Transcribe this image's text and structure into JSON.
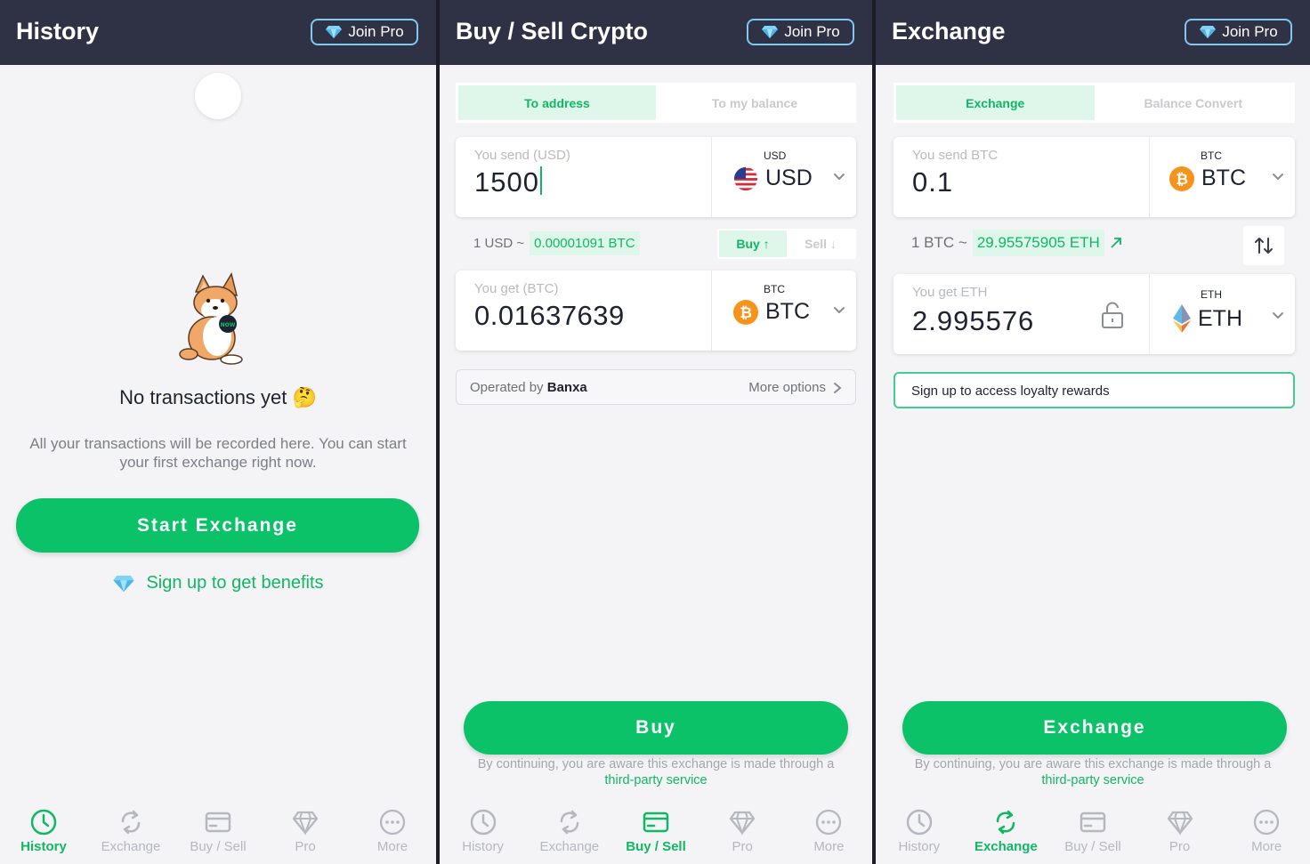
{
  "pro_label": "Join Pro",
  "nav": [
    "History",
    "Exchange",
    "Buy / Sell",
    "Pro",
    "More"
  ],
  "history": {
    "title": "History",
    "empty_title": "No transactions yet",
    "empty_emoji": "🤔",
    "empty_text": "All your transactions will be recorded here. You can start your first exchange right now.",
    "start_button": "Start Exchange",
    "signup_link": "Sign up to get benefits"
  },
  "buysell": {
    "title": "Buy / Sell Crypto",
    "tabs": [
      "To address",
      "To my balance"
    ],
    "send_label": "You send (USD)",
    "send_value": "1500",
    "send_currency_small": "USD",
    "send_currency": "USD",
    "rate_prefix": "1 USD ~",
    "rate_value": "0.00001091 BTC",
    "buy_toggle": "Buy ↑",
    "sell_toggle": "Sell ↓",
    "get_label": "You get (BTC)",
    "get_value": "0.01637639",
    "get_currency_small": "BTC",
    "get_currency": "BTC",
    "operated_prefix": "Operated by",
    "operated_by": "Banxa",
    "more_options": "More options",
    "buy_button": "Buy",
    "disclaimer": "By continuing, you are aware this exchange is made through a",
    "disclaimer_link": "third-party service"
  },
  "exchange": {
    "title": "Exchange",
    "tabs": [
      "Exchange",
      "Balance Convert"
    ],
    "send_label": "You send BTC",
    "send_value": "0.1",
    "send_currency_small": "BTC",
    "send_currency": "BTC",
    "rate_prefix": "1 BTC ~",
    "rate_value": "29.95575905 ETH",
    "get_label": "You get ETH",
    "get_value": "2.995576",
    "get_currency_small": "ETH",
    "get_currency": "ETH",
    "loyalty": "Sign up to access loyalty rewards",
    "exchange_button": "Exchange",
    "disclaimer": "By continuing, you are aware this exchange is made through a",
    "disclaimer_link": "third-party service"
  },
  "colors": {
    "accent": "#0cc268",
    "header": "#2f3144",
    "text_green": "#10b764"
  }
}
